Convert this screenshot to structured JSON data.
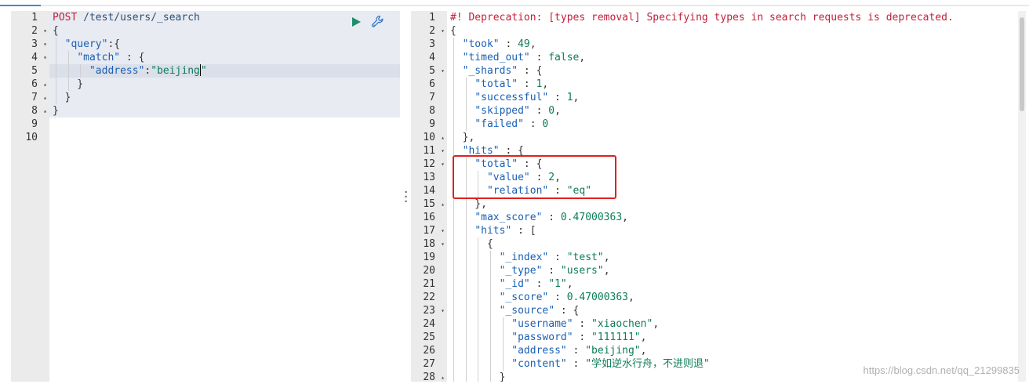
{
  "toolbar": {
    "play_icon": "play-icon",
    "wrench_icon": "wrench-icon"
  },
  "request": {
    "lines": [
      {
        "n": "1",
        "fold": "",
        "tokens": [
          [
            "method",
            "POST "
          ],
          [
            "url",
            "/test/users/_search"
          ]
        ]
      },
      {
        "n": "2",
        "fold": "▾",
        "tokens": [
          [
            "punc",
            "{"
          ]
        ]
      },
      {
        "n": "3",
        "fold": "▾",
        "tokens": [
          [
            "punc",
            "  "
          ],
          [
            "key",
            "\"query\""
          ],
          [
            "punc",
            ":{"
          ]
        ]
      },
      {
        "n": "4",
        "fold": "▾",
        "tokens": [
          [
            "punc",
            "    "
          ],
          [
            "key",
            "\"match\""
          ],
          [
            "punc",
            " : {"
          ]
        ]
      },
      {
        "n": "5",
        "fold": "",
        "tokens": [
          [
            "punc",
            "      "
          ],
          [
            "key",
            "\"address\""
          ],
          [
            "punc",
            ":"
          ],
          [
            "str",
            "\"beijing"
          ],
          [
            "cursor",
            ""
          ],
          [
            "str",
            "\""
          ]
        ]
      },
      {
        "n": "6",
        "fold": "▴",
        "tokens": [
          [
            "punc",
            "    }"
          ]
        ]
      },
      {
        "n": "7",
        "fold": "▴",
        "tokens": [
          [
            "punc",
            "  }"
          ]
        ]
      },
      {
        "n": "8",
        "fold": "▴",
        "tokens": [
          [
            "punc",
            "}"
          ]
        ]
      },
      {
        "n": "9",
        "fold": "",
        "tokens": []
      },
      {
        "n": "10",
        "fold": "",
        "tokens": []
      }
    ]
  },
  "response": {
    "lines": [
      {
        "n": "1",
        "fold": "",
        "tokens": [
          [
            "comment",
            "#! Deprecation: [types removal] Specifying types in search requests is deprecated."
          ]
        ]
      },
      {
        "n": "2",
        "fold": "▾",
        "tokens": [
          [
            "punc",
            "{"
          ]
        ]
      },
      {
        "n": "3",
        "fold": "",
        "tokens": [
          [
            "punc",
            "  "
          ],
          [
            "key",
            "\"took\""
          ],
          [
            "punc",
            " : "
          ],
          [
            "num",
            "49"
          ],
          [
            "punc",
            ","
          ]
        ]
      },
      {
        "n": "4",
        "fold": "",
        "tokens": [
          [
            "punc",
            "  "
          ],
          [
            "key",
            "\"timed_out\""
          ],
          [
            "punc",
            " : "
          ],
          [
            "bool",
            "false"
          ],
          [
            "punc",
            ","
          ]
        ]
      },
      {
        "n": "5",
        "fold": "▾",
        "tokens": [
          [
            "punc",
            "  "
          ],
          [
            "key",
            "\"_shards\""
          ],
          [
            "punc",
            " : {"
          ]
        ]
      },
      {
        "n": "6",
        "fold": "",
        "tokens": [
          [
            "punc",
            "    "
          ],
          [
            "key",
            "\"total\""
          ],
          [
            "punc",
            " : "
          ],
          [
            "num",
            "1"
          ],
          [
            "punc",
            ","
          ]
        ]
      },
      {
        "n": "7",
        "fold": "",
        "tokens": [
          [
            "punc",
            "    "
          ],
          [
            "key",
            "\"successful\""
          ],
          [
            "punc",
            " : "
          ],
          [
            "num",
            "1"
          ],
          [
            "punc",
            ","
          ]
        ]
      },
      {
        "n": "8",
        "fold": "",
        "tokens": [
          [
            "punc",
            "    "
          ],
          [
            "key",
            "\"skipped\""
          ],
          [
            "punc",
            " : "
          ],
          [
            "num",
            "0"
          ],
          [
            "punc",
            ","
          ]
        ]
      },
      {
        "n": "9",
        "fold": "",
        "tokens": [
          [
            "punc",
            "    "
          ],
          [
            "key",
            "\"failed\""
          ],
          [
            "punc",
            " : "
          ],
          [
            "num",
            "0"
          ]
        ]
      },
      {
        "n": "10",
        "fold": "▴",
        "tokens": [
          [
            "punc",
            "  },"
          ]
        ]
      },
      {
        "n": "11",
        "fold": "▾",
        "tokens": [
          [
            "punc",
            "  "
          ],
          [
            "key",
            "\"hits\""
          ],
          [
            "punc",
            " : {"
          ]
        ]
      },
      {
        "n": "12",
        "fold": "▾",
        "tokens": [
          [
            "punc",
            "    "
          ],
          [
            "key",
            "\"total\""
          ],
          [
            "punc",
            " : {"
          ]
        ]
      },
      {
        "n": "13",
        "fold": "",
        "tokens": [
          [
            "punc",
            "      "
          ],
          [
            "key",
            "\"value\""
          ],
          [
            "punc",
            " : "
          ],
          [
            "num",
            "2"
          ],
          [
            "punc",
            ","
          ]
        ]
      },
      {
        "n": "14",
        "fold": "",
        "tokens": [
          [
            "punc",
            "      "
          ],
          [
            "key",
            "\"relation\""
          ],
          [
            "punc",
            " : "
          ],
          [
            "str",
            "\"eq\""
          ]
        ]
      },
      {
        "n": "15",
        "fold": "▴",
        "tokens": [
          [
            "punc",
            "    },"
          ]
        ]
      },
      {
        "n": "16",
        "fold": "",
        "tokens": [
          [
            "punc",
            "    "
          ],
          [
            "key",
            "\"max_score\""
          ],
          [
            "punc",
            " : "
          ],
          [
            "num",
            "0.47000363"
          ],
          [
            "punc",
            ","
          ]
        ]
      },
      {
        "n": "17",
        "fold": "▾",
        "tokens": [
          [
            "punc",
            "    "
          ],
          [
            "key",
            "\"hits\""
          ],
          [
            "punc",
            " : ["
          ]
        ]
      },
      {
        "n": "18",
        "fold": "▾",
        "tokens": [
          [
            "punc",
            "      {"
          ]
        ]
      },
      {
        "n": "19",
        "fold": "",
        "tokens": [
          [
            "punc",
            "        "
          ],
          [
            "key",
            "\"_index\""
          ],
          [
            "punc",
            " : "
          ],
          [
            "str",
            "\"test\""
          ],
          [
            "punc",
            ","
          ]
        ]
      },
      {
        "n": "20",
        "fold": "",
        "tokens": [
          [
            "punc",
            "        "
          ],
          [
            "key",
            "\"_type\""
          ],
          [
            "punc",
            " : "
          ],
          [
            "str",
            "\"users\""
          ],
          [
            "punc",
            ","
          ]
        ]
      },
      {
        "n": "21",
        "fold": "",
        "tokens": [
          [
            "punc",
            "        "
          ],
          [
            "key",
            "\"_id\""
          ],
          [
            "punc",
            " : "
          ],
          [
            "str",
            "\"1\""
          ],
          [
            "punc",
            ","
          ]
        ]
      },
      {
        "n": "22",
        "fold": "",
        "tokens": [
          [
            "punc",
            "        "
          ],
          [
            "key",
            "\"_score\""
          ],
          [
            "punc",
            " : "
          ],
          [
            "num",
            "0.47000363"
          ],
          [
            "punc",
            ","
          ]
        ]
      },
      {
        "n": "23",
        "fold": "▾",
        "tokens": [
          [
            "punc",
            "        "
          ],
          [
            "key",
            "\"_source\""
          ],
          [
            "punc",
            " : {"
          ]
        ]
      },
      {
        "n": "24",
        "fold": "",
        "tokens": [
          [
            "punc",
            "          "
          ],
          [
            "key",
            "\"username\""
          ],
          [
            "punc",
            " : "
          ],
          [
            "str",
            "\"xiaochen\""
          ],
          [
            "punc",
            ","
          ]
        ]
      },
      {
        "n": "25",
        "fold": "",
        "tokens": [
          [
            "punc",
            "          "
          ],
          [
            "key",
            "\"password\""
          ],
          [
            "punc",
            " : "
          ],
          [
            "str",
            "\"111111\""
          ],
          [
            "punc",
            ","
          ]
        ]
      },
      {
        "n": "26",
        "fold": "",
        "tokens": [
          [
            "punc",
            "          "
          ],
          [
            "key",
            "\"address\""
          ],
          [
            "punc",
            " : "
          ],
          [
            "str",
            "\"beijing\""
          ],
          [
            "punc",
            ","
          ]
        ]
      },
      {
        "n": "27",
        "fold": "",
        "tokens": [
          [
            "punc",
            "          "
          ],
          [
            "key",
            "\"content\""
          ],
          [
            "punc",
            " : "
          ],
          [
            "str",
            "\"学如逆水行舟，不进则退\""
          ]
        ]
      },
      {
        "n": "28",
        "fold": "▴",
        "tokens": [
          [
            "punc",
            "        }"
          ]
        ]
      }
    ]
  },
  "watermark": "https://blog.csdn.net/qq_21299835",
  "colors": {
    "highlight_box": "#e02020",
    "accent": "#3f8ad1",
    "play": "#1d8f6a"
  }
}
